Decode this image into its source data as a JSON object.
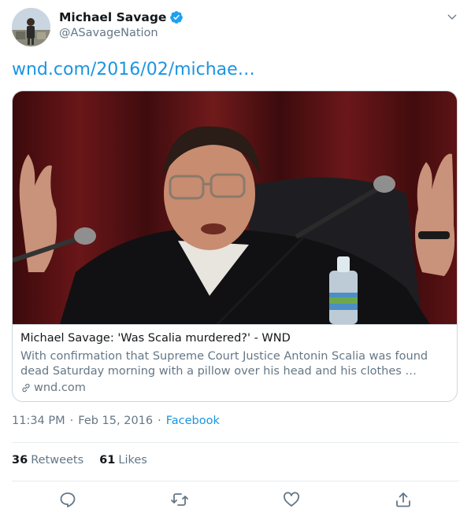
{
  "user": {
    "name": "Michael Savage",
    "handle": "@ASavageNation",
    "verified": true
  },
  "tweet": {
    "link_text": "wnd.com/2016/02/michae…",
    "time": "11:34 PM",
    "separator": "·",
    "date": "Feb 15, 2016",
    "source": "Facebook"
  },
  "card": {
    "title": "Michael Savage: 'Was Scalia murdered?' - WND",
    "description": "With confirmation that Supreme Court Justice Antonin Scalia was found dead Saturday morning with a pillow over his head and his clothes …",
    "domain": "wnd.com"
  },
  "stats": {
    "retweets_count": "36",
    "retweets_label": "Retweets",
    "likes_count": "61",
    "likes_label": "Likes"
  },
  "icons": {
    "verified": "verified-badge-icon",
    "caret": "chevron-down-icon",
    "reply": "reply-icon",
    "retweet": "retweet-icon",
    "like": "heart-icon",
    "share": "share-icon",
    "link": "link-icon"
  },
  "colors": {
    "accent": "#1b95e0",
    "secondary_text": "#657786",
    "border": "#ccd6dd"
  }
}
